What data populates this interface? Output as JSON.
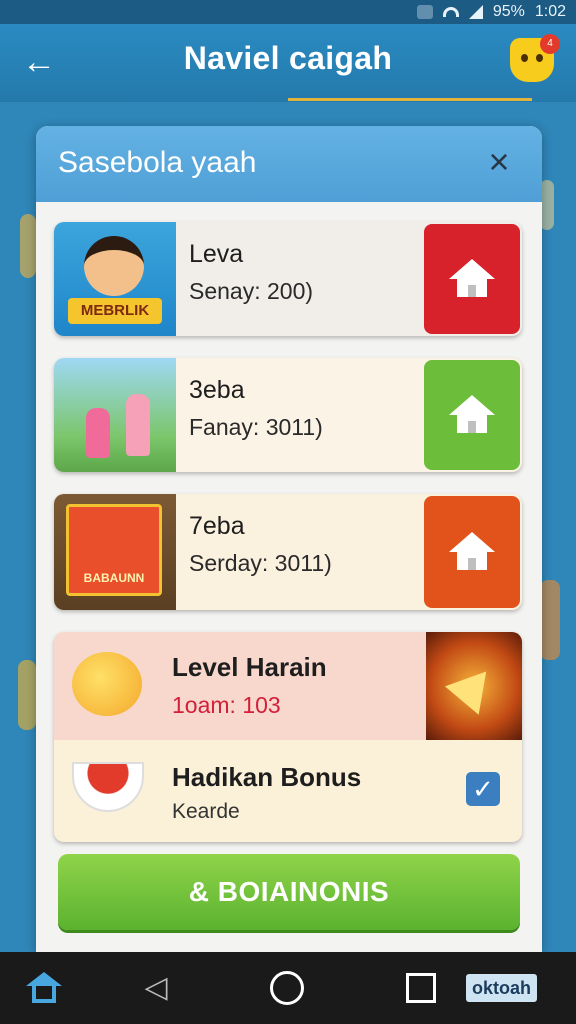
{
  "status_bar": {
    "battery": "95%",
    "time": "1:02"
  },
  "app_bar": {
    "title": "Naviel caigah",
    "notification_count": "4"
  },
  "dialog": {
    "title": "Sasebola yaah",
    "close_icon": "×",
    "cards": [
      {
        "title": "Leva",
        "subtitle": "Senay: 200)",
        "thumb_banner": "MEBRLIK",
        "button_color": "#d8222b"
      },
      {
        "title": "3eba",
        "subtitle": "Fanay: 3011)",
        "button_color": "#6cbd3a"
      },
      {
        "title": "7eba",
        "subtitle": "Serday: 3011)",
        "thumb_banner": "BABAUNN",
        "button_color": "#e2531c"
      }
    ],
    "bonus": {
      "level_title": "Level Harain",
      "level_sub": "1oam: 103",
      "bonus_title": "Hadikan Bonus",
      "bonus_sub": "Kearde",
      "checkbox_checked": true
    },
    "action_button": "& BOIAINONIS"
  },
  "nav_bar": {
    "brand": "oktoah"
  }
}
